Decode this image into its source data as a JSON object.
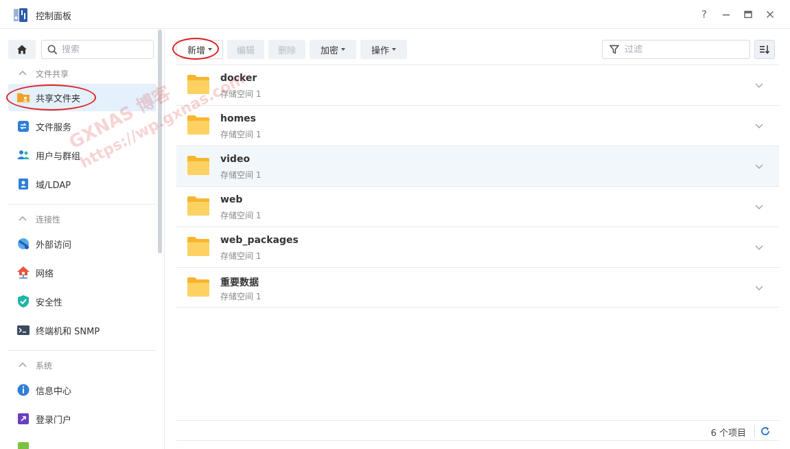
{
  "window": {
    "title": "控制面板",
    "controls": {
      "help": "?",
      "minimize": "—",
      "maximize": "▢",
      "close": "✕"
    }
  },
  "sidebar": {
    "search_placeholder": "搜索",
    "sections": [
      {
        "label": "文件共享",
        "items": [
          {
            "label": "共享文件夹",
            "icon": "shared-folder-icon",
            "active": true
          },
          {
            "label": "文件服务",
            "icon": "file-services-icon"
          },
          {
            "label": "用户与群组",
            "icon": "users-groups-icon"
          },
          {
            "label": "域/LDAP",
            "icon": "domain-ldap-icon"
          }
        ]
      },
      {
        "label": "连接性",
        "items": [
          {
            "label": "外部访问",
            "icon": "external-access-icon"
          },
          {
            "label": "网络",
            "icon": "network-icon"
          },
          {
            "label": "安全性",
            "icon": "security-shield-icon"
          },
          {
            "label": "终端机和 SNMP",
            "icon": "terminal-icon"
          }
        ]
      },
      {
        "label": "系统",
        "items": [
          {
            "label": "信息中心",
            "icon": "info-center-icon"
          },
          {
            "label": "登录门户",
            "icon": "login-portal-icon"
          }
        ]
      }
    ]
  },
  "toolbar": {
    "new_label": "新增",
    "edit_label": "编辑",
    "delete_label": "删除",
    "encrypt_label": "加密",
    "action_label": "操作",
    "filter_placeholder": "过滤"
  },
  "folders": [
    {
      "name": "docker",
      "volume": "存储空间 1"
    },
    {
      "name": "homes",
      "volume": "存储空间 1"
    },
    {
      "name": "video",
      "volume": "存储空间 1"
    },
    {
      "name": "web",
      "volume": "存储空间 1"
    },
    {
      "name": "web_packages",
      "volume": "存储空间 1"
    },
    {
      "name": "重要数据",
      "volume": "存储空间 1"
    }
  ],
  "footer": {
    "count_label": "6 个项目"
  },
  "watermark": {
    "line1": "GXNAS 博客",
    "line2": "https://wp.gxnas.com"
  },
  "colors": {
    "accent": "#1a73d9",
    "folder": "#fbc53a",
    "annotation": "#e02020"
  }
}
